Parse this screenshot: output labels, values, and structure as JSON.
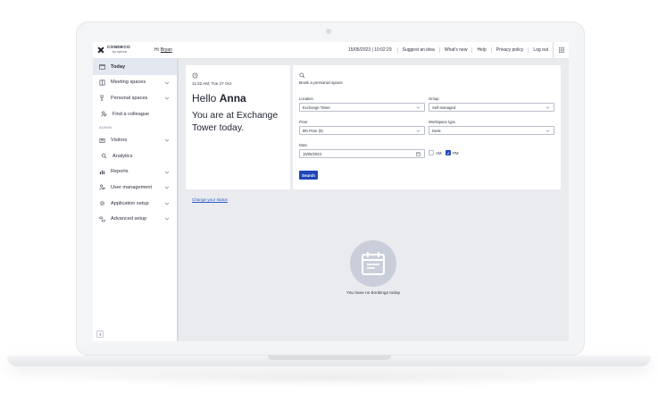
{
  "brand": {
    "name": "CONDECO",
    "sub": "by eptura"
  },
  "header": {
    "greeting_prefix": "Hi",
    "user": "Bryan",
    "datetime": "15/05/2023 | 10:02:29",
    "links": [
      "Suggest an idea",
      "What's new",
      "Help",
      "Privacy policy",
      "Log out"
    ],
    "apps_icon": "grid-icon"
  },
  "sidebar": {
    "items": [
      {
        "label": "Today",
        "icon": "calendar-icon",
        "active": true,
        "expandable": false
      },
      {
        "label": "Meeting spaces",
        "icon": "meeting-room-icon",
        "expandable": true
      },
      {
        "label": "Personal spaces",
        "icon": "desk-chair-icon",
        "expandable": true
      },
      {
        "label": "Find a colleague",
        "icon": "people-search-icon",
        "expandable": false
      }
    ],
    "section_label": "ADMIN",
    "admin_items": [
      {
        "label": "Visitors",
        "icon": "visitor-badge-icon",
        "expandable": true
      },
      {
        "label": "Analytics",
        "icon": "analytics-search-icon",
        "expandable": false
      },
      {
        "label": "Reports",
        "icon": "bar-chart-icon",
        "expandable": true
      },
      {
        "label": "User management",
        "icon": "users-gear-icon",
        "expandable": true
      },
      {
        "label": "Application setup",
        "icon": "gear-icon",
        "expandable": true
      },
      {
        "label": "Advanced setup",
        "icon": "toggles-icon",
        "expandable": true
      }
    ]
  },
  "welcome": {
    "datetime": "11:32 AM, Tue 27 Oct",
    "hello_prefix": "Hello",
    "name": "Anna",
    "location_message": "You are at Exchange Tower today.",
    "status_link": "Change your status"
  },
  "booking": {
    "title": "Book a personal space",
    "location": {
      "label": "Location",
      "value": "Exchange Tower"
    },
    "group": {
      "label": "Group",
      "value": "Self-managed"
    },
    "floor": {
      "label": "Floor",
      "value": "8th Floor (8)"
    },
    "workspace_type": {
      "label": "Workspace type",
      "value": "Desk"
    },
    "date": {
      "label": "Date",
      "value": "15/05/2023"
    },
    "am": {
      "label": "AM",
      "checked": false
    },
    "pm": {
      "label": "PM",
      "checked": true
    },
    "search_label": "Search"
  },
  "empty_state": {
    "message": "You have no bookings today"
  },
  "colors": {
    "accent": "#1f47b8",
    "link": "#2d57c8",
    "background": "#e9ebef"
  }
}
